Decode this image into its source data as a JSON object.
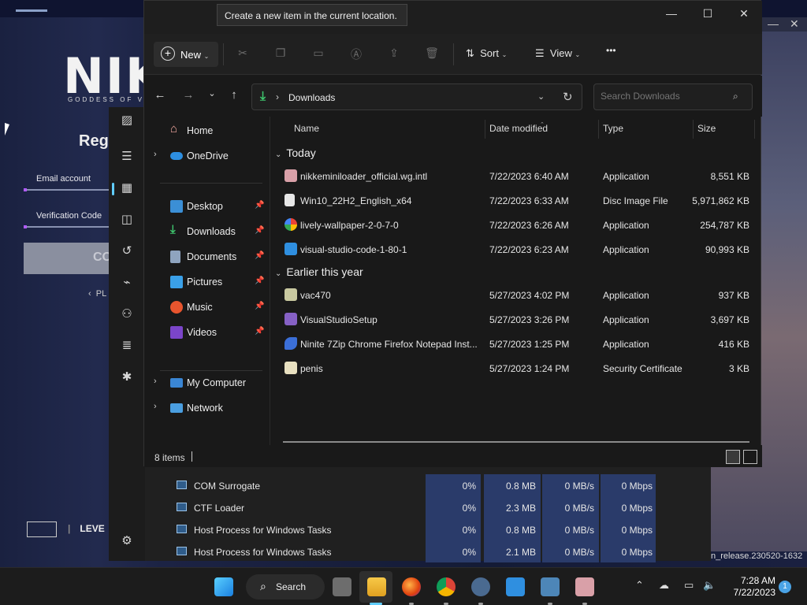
{
  "game": {
    "logo": "NIKK",
    "logo_sub": "GODDESS OF VIC",
    "title": "Regis",
    "email_label": "Email account",
    "verification_label": "Verification Code",
    "button_partial": "CO",
    "back_partial": "PL",
    "brand": "LEVE"
  },
  "task_manager": {
    "rows": [
      {
        "name": "COM Surrogate",
        "cpu": "0%",
        "memory": "0.8 MB",
        "disk": "0 MB/s",
        "network": "0 Mbps"
      },
      {
        "name": "CTF Loader",
        "cpu": "0%",
        "memory": "2.3 MB",
        "disk": "0 MB/s",
        "network": "0 Mbps"
      },
      {
        "name": "Host Process for Windows Tasks",
        "cpu": "0%",
        "memory": "0.8 MB",
        "disk": "0 MB/s",
        "network": "0 Mbps"
      },
      {
        "name": "Host Process for Windows Tasks",
        "cpu": "0%",
        "memory": "2.1 MB",
        "disk": "0 MB/s",
        "network": "0 Mbps"
      }
    ],
    "build_text": "n_release.230520-1632"
  },
  "explorer": {
    "tooltip": "Create a new item in the current location.",
    "command_bar": {
      "new_label": "New",
      "sort_label": "Sort",
      "view_label": "View",
      "more_label": "•••"
    },
    "address": {
      "path": "Downloads",
      "search_placeholder": "Search Downloads"
    },
    "nav": {
      "home": "Home",
      "onedrive": "OneDrive",
      "quick_access": [
        "Desktop",
        "Downloads",
        "Documents",
        "Pictures",
        "Music",
        "Videos"
      ],
      "my_computer": "My Computer",
      "network": "Network"
    },
    "columns": {
      "name": "Name",
      "date": "Date modified",
      "type": "Type",
      "size": "Size"
    },
    "groups": [
      {
        "label": "Today",
        "files": [
          {
            "name": "nikkeminiloader_official.wg.intl",
            "date": "7/22/2023 6:40 AM",
            "type": "Application",
            "size": "8,551 KB"
          },
          {
            "name": "Win10_22H2_English_x64",
            "date": "7/22/2023 6:33 AM",
            "type": "Disc Image File",
            "size": "5,971,862 KB"
          },
          {
            "name": "lively-wallpaper-2-0-7-0",
            "date": "7/22/2023 6:26 AM",
            "type": "Application",
            "size": "254,787 KB"
          },
          {
            "name": "visual-studio-code-1-80-1",
            "date": "7/22/2023 6:23 AM",
            "type": "Application",
            "size": "90,993 KB"
          }
        ]
      },
      {
        "label": "Earlier this year",
        "files": [
          {
            "name": "vac470",
            "date": "5/27/2023 4:02 PM",
            "type": "Application",
            "size": "937 KB"
          },
          {
            "name": "VisualStudioSetup",
            "date": "5/27/2023 3:26 PM",
            "type": "Application",
            "size": "3,697 KB"
          },
          {
            "name": "Ninite 7Zip Chrome Firefox Notepad Inst...",
            "date": "5/27/2023 1:25 PM",
            "type": "Application",
            "size": "416 KB"
          },
          {
            "name": "penis",
            "date": "5/27/2023 1:24 PM",
            "type": "Security Certificate",
            "size": "3 KB"
          }
        ]
      }
    ],
    "status": {
      "item_count": "8 items"
    }
  },
  "taskbar": {
    "search_label": "Search",
    "time": "7:28 AM",
    "date": "7/22/2023",
    "notification_count": "1"
  }
}
